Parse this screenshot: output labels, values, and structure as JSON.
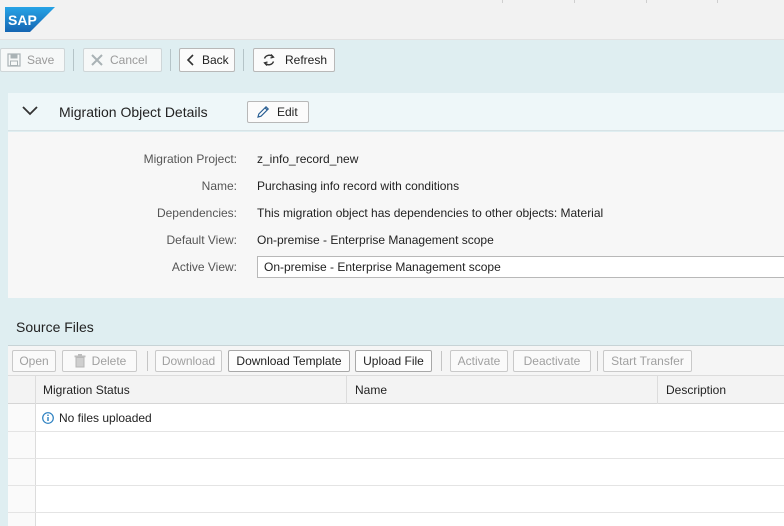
{
  "shell": {
    "logo_text": "SAP"
  },
  "toolbar": {
    "save": "Save",
    "cancel": "Cancel",
    "back": "Back",
    "refresh": "Refresh"
  },
  "details": {
    "title": "Migration Object Details",
    "edit": "Edit",
    "fields": [
      {
        "label": "Migration Project:",
        "value": "z_info_record_new"
      },
      {
        "label": "Name:",
        "value": "Purchasing info record with conditions"
      },
      {
        "label": "Dependencies:",
        "value": "This migration object has dependencies to other objects: Material"
      },
      {
        "label": "Default View:",
        "value": "On-premise - Enterprise Management scope"
      },
      {
        "label": "Active View:",
        "value": "On-premise - Enterprise Management scope"
      }
    ]
  },
  "source_files": {
    "title": "Source Files",
    "buttons": {
      "open": "Open",
      "delete": "Delete",
      "download": "Download",
      "download_template": "Download Template",
      "upload_file": "Upload File",
      "activate": "Activate",
      "deactivate": "Deactivate",
      "start_transfer": "Start Transfer"
    },
    "columns": [
      "Migration Status",
      "Name",
      "Description"
    ],
    "empty_message": "No files uploaded"
  },
  "colors": {
    "sap_blue": "#1a7fc1",
    "background": "#dfeef1",
    "info_icon": "#2a7fc0"
  }
}
